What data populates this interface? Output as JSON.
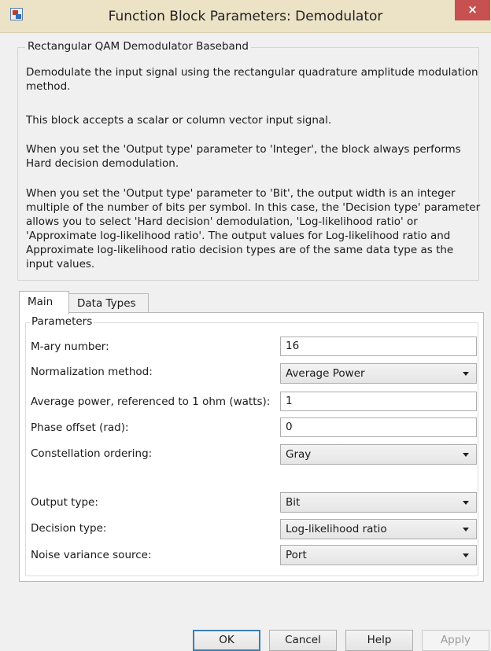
{
  "window": {
    "title": "Function Block Parameters: Demodulator",
    "close_label": "×"
  },
  "description": {
    "group_label": "Rectangular QAM Demodulator Baseband",
    "paragraphs": [
      "Demodulate the input signal using the rectangular quadrature amplitude modulation method.",
      "This block accepts a scalar or column vector input signal.",
      "When you set the 'Output type' parameter to 'Integer', the block always performs Hard decision demodulation.",
      "When you set the 'Output type' parameter to 'Bit', the output width is an integer multiple of the number of bits per symbol. In this case, the 'Decision type' parameter allows you to select 'Hard decision' demodulation, 'Log-likelihood ratio' or 'Approximate log-likelihood ratio'. The output values for Log-likelihood ratio and Approximate log-likelihood ratio decision types are of the same data type as the input values."
    ]
  },
  "tabs": [
    "Main",
    "Data Types"
  ],
  "parameters": {
    "group_label": "Parameters",
    "m_ary_label": "M-ary number:",
    "m_ary_value": "16",
    "normalization_label": "Normalization method:",
    "normalization_value": "Average Power",
    "avg_power_label": "Average power, referenced to 1 ohm (watts):",
    "avg_power_value": "1",
    "phase_offset_label": "Phase offset (rad):",
    "phase_offset_value": "0",
    "constellation_label": "Constellation ordering:",
    "constellation_value": "Gray",
    "output_type_label": "Output type:",
    "output_type_value": "Bit",
    "decision_type_label": "Decision type:",
    "decision_type_value": "Log-likelihood ratio",
    "noise_variance_label": "Noise variance source:",
    "noise_variance_value": "Port"
  },
  "buttons": {
    "ok": "OK",
    "cancel": "Cancel",
    "help": "Help",
    "apply": "Apply"
  }
}
